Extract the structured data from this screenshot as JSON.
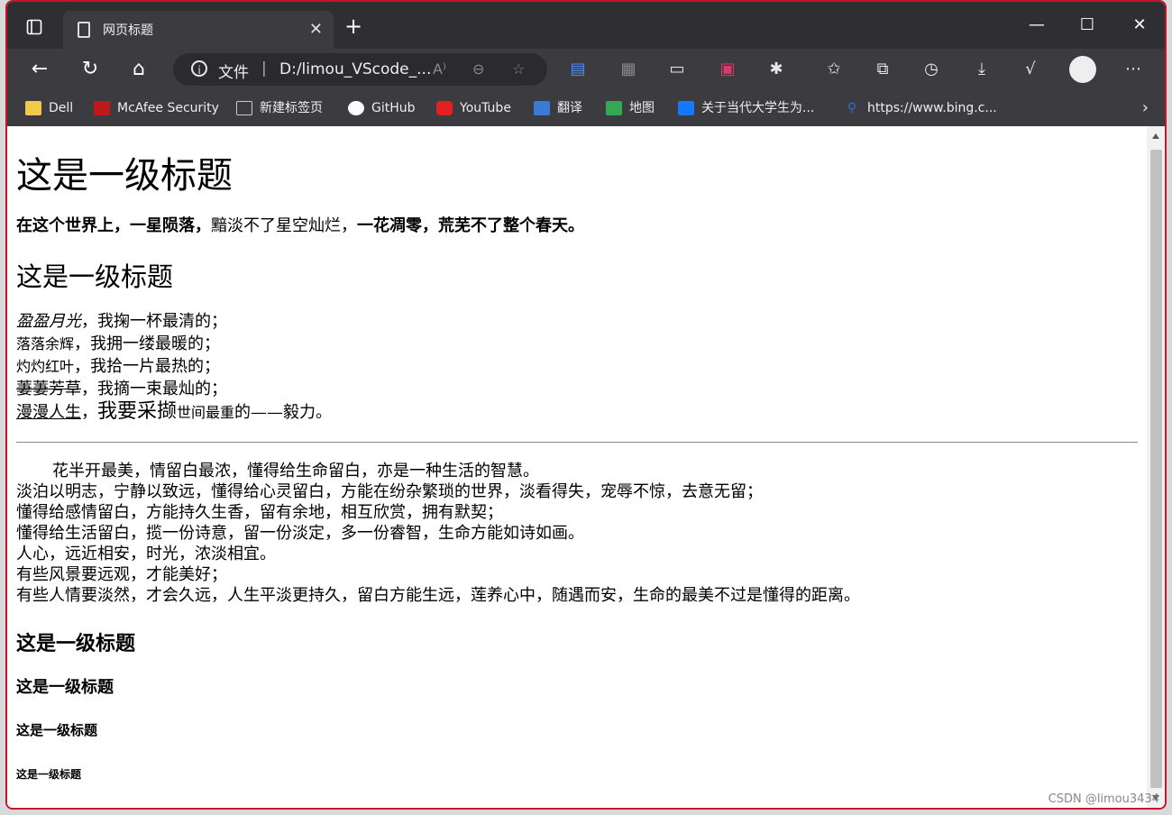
{
  "tab": {
    "title": "网页标题"
  },
  "address": {
    "label": "文件",
    "separator": "|",
    "url": "D:/limou_VScode_..."
  },
  "bookmarks": [
    {
      "label": "Dell",
      "color": "#f2c94c"
    },
    {
      "label": "McAfee Security",
      "color": "#c01818"
    },
    {
      "label": "新建标签页",
      "color": "#777777"
    },
    {
      "label": "GitHub",
      "color": "#ffffff"
    },
    {
      "label": "YouTube",
      "color": "#e52020"
    },
    {
      "label": "翻译",
      "color": "#3a7bd5"
    },
    {
      "label": "地图",
      "color": "#34a853"
    },
    {
      "label": "关于当代大学生为...",
      "color": "#1677ff"
    },
    {
      "label": "https://www.bing.c...",
      "color": "#2b6fd6"
    }
  ],
  "content": {
    "h1": "这是一级标题",
    "p1": {
      "bold1": "在这个世界上，一星陨落，",
      "normal": "黯淡不了星空灿烂，",
      "bold2": "一花凋零，荒芜不了整个春天。"
    },
    "h2": "这是一级标题",
    "lines": [
      {
        "styled": "盈盈月光",
        "rest": "，我掬一杯最清的；"
      },
      {
        "styled": "落落余辉",
        "rest": "，我拥一缕最暖的；"
      },
      {
        "styled": "灼灼红叶",
        "rest": "，我拾一片最热的；"
      },
      {
        "styled": "萋萋芳草",
        "rest": "，我摘一束最灿的；"
      },
      {
        "styled": "漫漫人生",
        "rest": "，",
        "big": "我要采撷",
        "small": "世间最重",
        "tail": "的——毅力。"
      }
    ],
    "para": [
      "花半开最美，情留白最浓，懂得给生命留白，亦是一种生活的智慧。",
      "淡泊以明志，宁静以致远，懂得给心灵留白，方能在纷杂繁琐的世界，淡看得失，宠辱不惊，去意无留；",
      "懂得给感情留白，方能持久生香，留有余地，相互欣赏，拥有默契；",
      "懂得给生活留白，揽一份诗意，留一份淡定，多一份睿智，生命方能如诗如画。",
      "人心，远近相安，时光，浓淡相宜。",
      "有些风景要远观，才能美好；",
      "有些人情要淡然，才会久远，人生平淡更持久，留白方能生远，莲养心中，随遇而安，生命的最美不过是懂得的距离。"
    ],
    "h3": "这是一级标题",
    "h4": "这是一级标题",
    "h5": "这是一级标题",
    "h6": "这是一级标题"
  },
  "watermark": "CSDN @limou3434"
}
